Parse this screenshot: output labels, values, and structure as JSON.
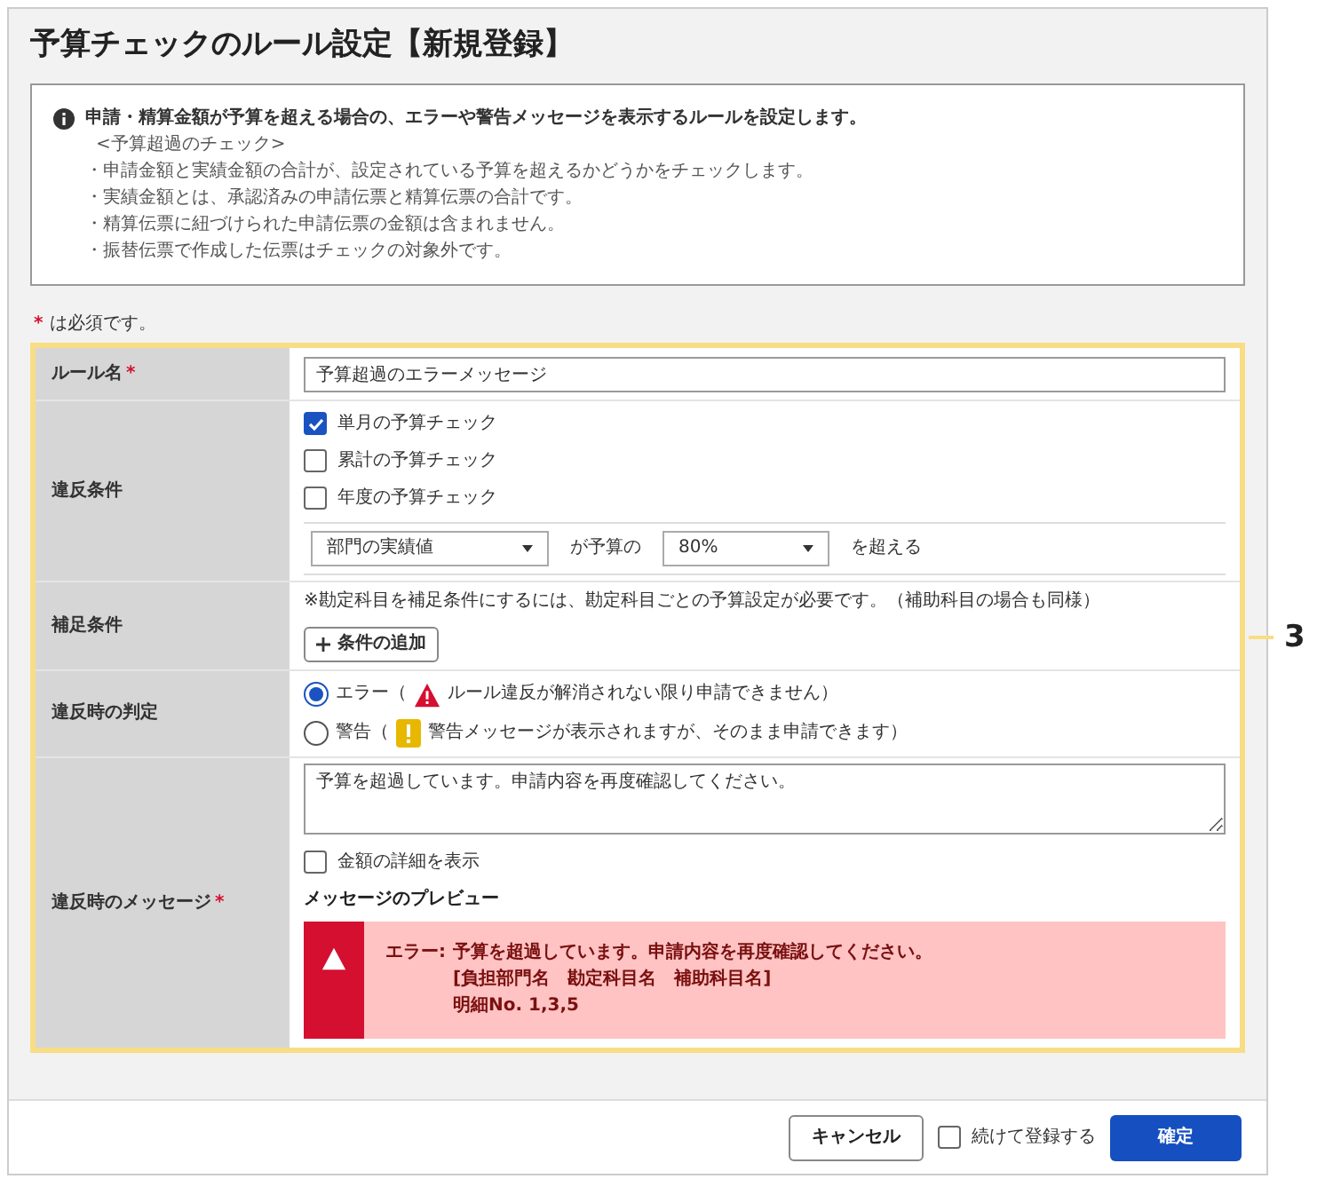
{
  "title": "予算チェックのルール設定【新規登録】",
  "info": {
    "headline": "申請・精算金額が予算を超える場合の、エラーや警告メッセージを表示するルールを設定します。",
    "subheading": "<予算超過のチェック>",
    "bullets": [
      "・申請金額と実績金額の合計が、設定されている予算を超えるかどうかをチェックします。",
      "・実績金額とは、承認済みの申請伝票と精算伝票の合計です。",
      "・精算伝票に紐づけられた申請伝票の金額は含まれません。",
      "・振替伝票で作成した伝票はチェックの対象外です。"
    ]
  },
  "required_note": {
    "mark": "*",
    "text": "は必須です。"
  },
  "form": {
    "highlighted": true,
    "callout": "3",
    "rule_name": {
      "label": "ルール名",
      "required": true,
      "value": "予算超過のエラーメッセージ"
    },
    "violation": {
      "label": "違反条件",
      "checks": [
        {
          "label": "単月の予算チェック",
          "checked": true
        },
        {
          "label": "累計の予算チェック",
          "checked": false
        },
        {
          "label": "年度の予算チェック",
          "checked": false
        }
      ],
      "basis": "部門の実績値",
      "middle": "が予算の",
      "percent": "80%",
      "suffix": "を超える"
    },
    "supplement": {
      "label": "補足条件",
      "note": "※勘定科目を補足条件にするには、勘定科目ごとの予算設定が必要です。（補助科目の場合も同様）",
      "button": "条件の追加"
    },
    "judgement": {
      "label": "違反時の判定",
      "options": [
        {
          "kind": "error",
          "label": "エラー（",
          "note": "ルール違反が解消されない限り申請できません）",
          "selected": true
        },
        {
          "kind": "warning",
          "label": "警告（",
          "note": "警告メッセージが表示されますが、そのまま申請できます）",
          "selected": false
        }
      ]
    },
    "message": {
      "label": "違反時のメッセージ",
      "required": true,
      "value": "予算を超過しています。申請内容を再度確認してください。",
      "detail": {
        "label": "金額の詳細を表示",
        "checked": false
      },
      "preview_title": "メッセージのプレビュー",
      "preview": {
        "kind": "error",
        "prefix": "エラー:",
        "lines": [
          "予算を超過しています。申請内容を再度確認してください。",
          "[負担部門名　勘定科目名　補助科目名]",
          "明細No. 1,3,5"
        ]
      }
    }
  },
  "footer": {
    "cancel": "キャンセル",
    "continue": {
      "label": "続けて登録する",
      "checked": false
    },
    "confirm": "確定"
  }
}
